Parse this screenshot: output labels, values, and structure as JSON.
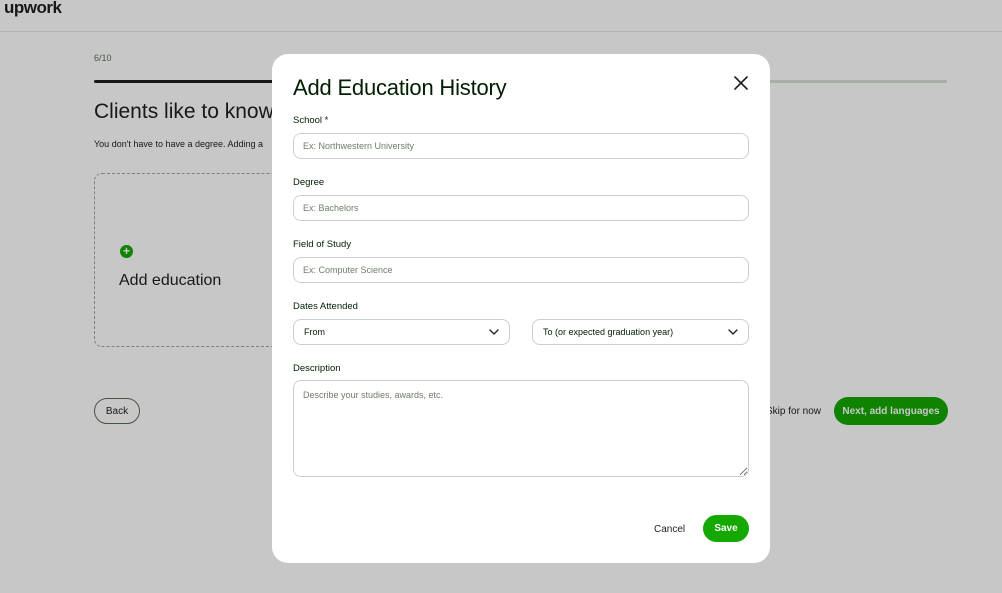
{
  "app": {
    "logo_text": "upwork"
  },
  "background": {
    "step_indicator": "6/10",
    "progress_fraction": 0.6,
    "heading": "Clients like to know",
    "subtext": "You don't have to have a degree. Adding a",
    "add_card_label": "Add education",
    "back_label": "Back",
    "skip_label": "Skip for now",
    "next_label": "Next, add languages"
  },
  "modal": {
    "title": "Add Education History",
    "school": {
      "label": "School *",
      "placeholder": "Ex: Northwestern University",
      "value": ""
    },
    "degree": {
      "label": "Degree",
      "placeholder": "Ex: Bachelors",
      "value": ""
    },
    "field_of_study": {
      "label": "Field of Study",
      "placeholder": "Ex: Computer Science",
      "value": ""
    },
    "dates": {
      "label": "Dates Attended",
      "from_selected": "From",
      "to_selected": "To (or expected graduation year)"
    },
    "description": {
      "label": "Description",
      "placeholder": "Describe your studies, awards, etc.",
      "value": ""
    },
    "cancel_label": "Cancel",
    "save_label": "Save"
  },
  "colors": {
    "accent": "#14a800",
    "overlay": "rgba(0,0,0,0.22)",
    "text": "#001e00"
  },
  "icons": {
    "close": "close-icon",
    "chevron": "chevron-down-icon",
    "plus": "plus-circle-icon"
  }
}
